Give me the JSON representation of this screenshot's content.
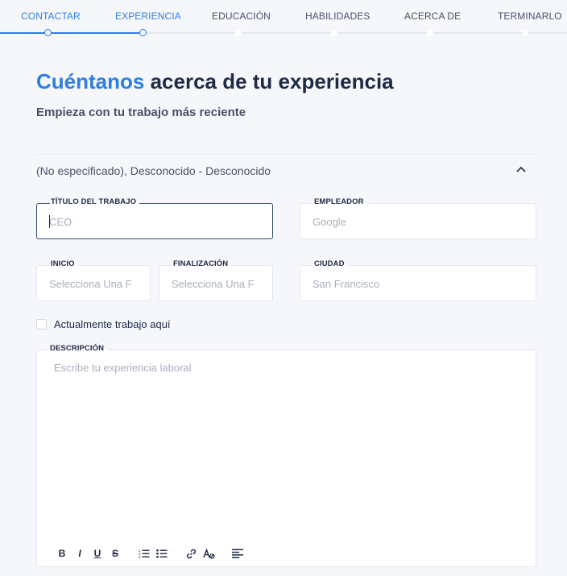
{
  "stepper": {
    "steps": [
      {
        "label": "CONTACTAR",
        "state": "done"
      },
      {
        "label": "EXPERIENCIA",
        "state": "current"
      },
      {
        "label": "EDUCACIÓN",
        "state": "pending"
      },
      {
        "label": "HABILIDADES",
        "state": "pending"
      },
      {
        "label": "ACERCA DE",
        "state": "pending"
      },
      {
        "label": "TERMINARLO",
        "state": "pending"
      }
    ]
  },
  "header": {
    "title_accent": "Cuéntanos",
    "title_rest": " acerca de tu experiencia",
    "subtitle": "Empieza con tu trabajo más reciente"
  },
  "entry": {
    "summary": "(No especificado), Desconocido - Desconocido",
    "collapse_icon": "chevron-up-icon"
  },
  "form": {
    "job_title": {
      "label": "TÍTULO DEL TRABAJO",
      "placeholder": "CEO"
    },
    "employer": {
      "label": "EMPLEADOR",
      "placeholder": "Google"
    },
    "start": {
      "label": "INICIO",
      "placeholder": "Selecciona Una F"
    },
    "end": {
      "label": "FINALIZACIÓN",
      "placeholder": "Selecciona Una F"
    },
    "city": {
      "label": "CIUDAD",
      "placeholder": "San Francisco"
    },
    "current_job": {
      "label": "Actualmente trabajo aquí",
      "checked": false
    },
    "description": {
      "label": "DESCRIPCIÓN",
      "placeholder": "Escribe tu experiencia laboral"
    }
  },
  "editor_toolbar": {
    "bold": "B",
    "italic": "I",
    "underline": "U",
    "strike": "S",
    "icons": [
      "ordered-list-icon",
      "bullet-list-icon",
      "link-icon",
      "clear-format-icon",
      "align-left-icon"
    ]
  },
  "colors": {
    "accent": "#2f7ee1",
    "text": "#1f2a44",
    "muted": "#4a5165",
    "placeholder": "#a9afbd",
    "background": "#f6f7fb"
  }
}
